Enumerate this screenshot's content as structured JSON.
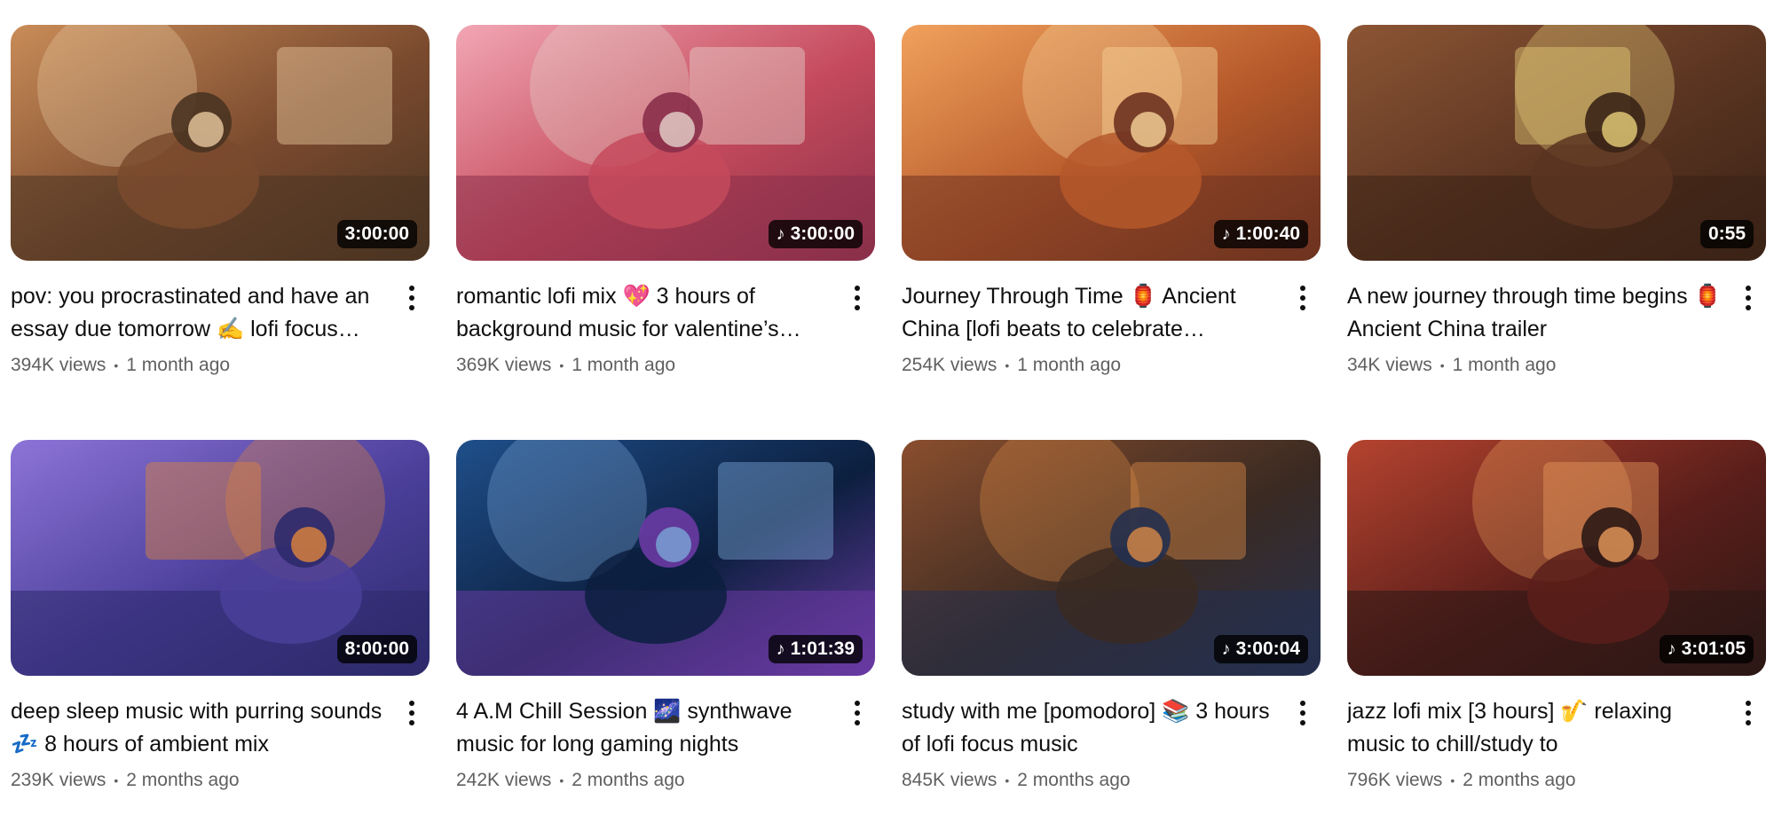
{
  "videos": [
    {
      "title": "pov: you procrastinated and have an essay due tomorrow ✍️ lofi focus…",
      "duration": "3:00:00",
      "has_music_icon": false,
      "views": "394K views",
      "age": "1 month ago",
      "palette": [
        "#7a4a2e",
        "#c98c58",
        "#e9c9a0",
        "#4a3422"
      ]
    },
    {
      "title": "romantic lofi mix 💖 3 hours of background music for valentine’s…",
      "duration": "3:00:00",
      "has_music_icon": true,
      "views": "369K views",
      "age": "1 month ago",
      "palette": [
        "#c44a5c",
        "#f2a6b4",
        "#e6d3cc",
        "#8a2f4a"
      ]
    },
    {
      "title": "Journey Through Time 🏮 Ancient China [lofi beats to celebrate…",
      "duration": "1:00:40",
      "has_music_icon": true,
      "views": "254K views",
      "age": "1 month ago",
      "palette": [
        "#b5582a",
        "#f1a15c",
        "#f7d49a",
        "#6e3320"
      ]
    },
    {
      "title": "A new journey through time begins 🏮 Ancient China trailer",
      "duration": "0:55",
      "has_music_icon": false,
      "views": "34K views",
      "age": "1 month ago",
      "palette": [
        "#5a3421",
        "#8c5534",
        "#e7cf7a",
        "#3a2316"
      ]
    },
    {
      "title": "deep sleep music with purring sounds 💤 8 hours of ambient mix",
      "duration": "8:00:00",
      "has_music_icon": false,
      "views": "239K views",
      "age": "2 months ago",
      "palette": [
        "#4b3f9a",
        "#8c74d6",
        "#e0843a",
        "#2d2a6b"
      ]
    },
    {
      "title": "4 A.M Chill Session 🌌 synthwave music for long gaming nights",
      "duration": "1:01:39",
      "has_music_icon": true,
      "views": "242K views",
      "age": "2 months ago",
      "palette": [
        "#0c1f3f",
        "#1f4f8a",
        "#7aa6d6",
        "#6a3aa3"
      ]
    },
    {
      "title": "study with me [pomodoro] 📚 3 hours of lofi focus music",
      "duration": "3:00:04",
      "has_music_icon": true,
      "views": "845K views",
      "age": "2 months ago",
      "palette": [
        "#3a2a22",
        "#8a4e2e",
        "#d98a46",
        "#25304f"
      ]
    },
    {
      "title": "jazz lofi mix [3 hours] 🎷 relaxing music to chill/study to",
      "duration": "3:01:05",
      "has_music_icon": true,
      "views": "796K views",
      "age": "2 months ago",
      "palette": [
        "#5a1e1a",
        "#b5432f",
        "#e89a5a",
        "#2c1816"
      ]
    }
  ],
  "icons": {
    "music_note": "♪",
    "separator": "•"
  }
}
